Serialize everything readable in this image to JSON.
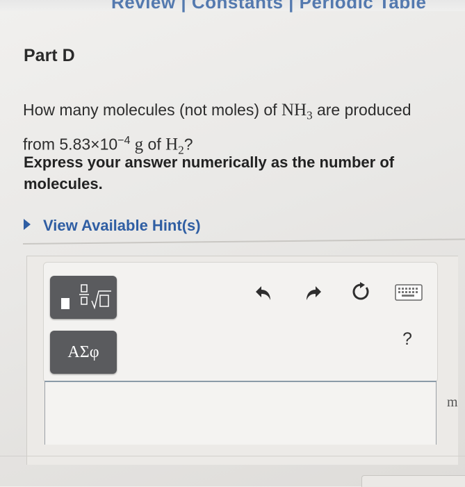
{
  "header": {
    "title": "Review | Constants | Periodic Table"
  },
  "part": {
    "title": "Part D"
  },
  "question": {
    "prefix": "How many molecules (not moles) of ",
    "nh3": "NH",
    "nh3_sub": "3",
    "mid": " are produced from 5.83×10",
    "exponent": "−4",
    "grams": " g",
    "of": " of ",
    "h2": "H",
    "h2_sub": "2",
    "suffix": "?"
  },
  "instruction": "Express your answer numerically as the number of molecules.",
  "hint": {
    "label": "View Available Hint(s)"
  },
  "toolbar": {
    "templates_icon": "templates-icon",
    "symbols_label": "ΑΣφ",
    "undo_icon": "undo-icon",
    "redo_icon": "redo-icon",
    "reset_icon": "reset-icon",
    "keyboard_icon": "keyboard-icon",
    "help_label": "?"
  },
  "answer": {
    "value": "",
    "unit_hint": "m"
  }
}
